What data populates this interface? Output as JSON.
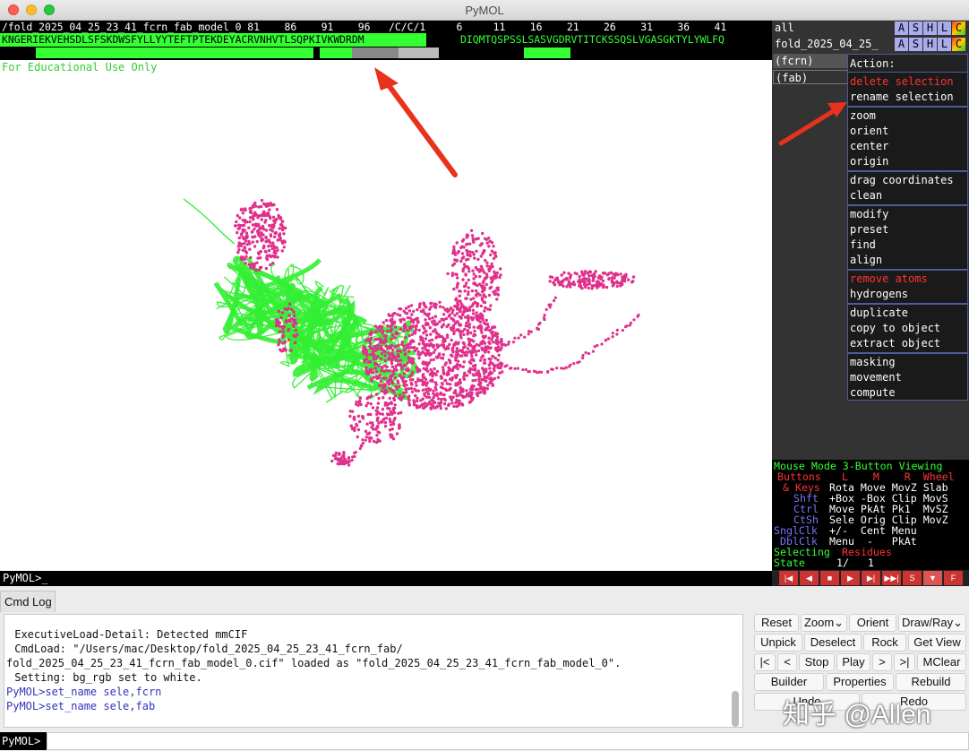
{
  "window": {
    "title": "PyMOL"
  },
  "sequence": {
    "header_line": "/fold_2025_04_25_23_41_fcrn_fab_model_0 81    86    91    96   /C/C/1     6     11    16    21    26    31    36    41",
    "chain_a_residues": "KNGERIEKVEHSDLSFSKDWSFYLLYYTEFTPTEKDEYACRVNHVTLSQPKIVKWDRDM",
    "chain_c_residues": "DIQMTQSPSSLSASVGDRVTITCKSSQSLVGASGKTYLYWLFQ",
    "track_colors": {
      "selected": "#33ff33",
      "highlight": "#888888",
      "dim": "#bbbbbb",
      "marker": "#000000"
    }
  },
  "viewer": {
    "notice": "For Educational Use Only",
    "command_prompt": "PyMOL>_",
    "colors": {
      "cartoon": "#33ee33",
      "sticks": "#e0308c",
      "background": "#ffffff"
    }
  },
  "objects": [
    {
      "name": "all"
    },
    {
      "name": "fold_2025_04_25_"
    },
    {
      "name": "(fcrn)"
    },
    {
      "name": "(fab)"
    }
  ],
  "asblc_buttons": [
    "A",
    "S",
    "H",
    "L",
    "C"
  ],
  "asblc_colors": {
    "A": "#aaaaee",
    "S": "#aaaaee",
    "H": "#aaaaee",
    "L": "#aaaaee",
    "C": "#ee7733"
  },
  "action_menu": {
    "title": "Action:",
    "groups": [
      [
        {
          "label": "delete selection",
          "danger": true
        },
        {
          "label": "rename selection",
          "danger": false
        }
      ],
      [
        {
          "label": "zoom"
        },
        {
          "label": "orient"
        },
        {
          "label": "center"
        },
        {
          "label": "origin"
        }
      ],
      [
        {
          "label": "drag coordinates"
        },
        {
          "label": "clean"
        }
      ],
      [
        {
          "label": "modify"
        },
        {
          "label": "preset"
        },
        {
          "label": "find"
        },
        {
          "label": "align"
        }
      ],
      [
        {
          "label": "remove atoms",
          "danger": true
        },
        {
          "label": "hydrogens"
        }
      ],
      [
        {
          "label": "duplicate"
        },
        {
          "label": "copy to object"
        },
        {
          "label": "extract object"
        }
      ],
      [
        {
          "label": "masking"
        },
        {
          "label": "movement"
        },
        {
          "label": "compute"
        }
      ]
    ]
  },
  "mouse_mode": {
    "title": "Mouse Mode 3-Button Viewing",
    "buttons_label": "Buttons",
    "columns": "L    M    R  Wheel",
    "rows": [
      {
        "key": "& Keys",
        "values": "Rota Move MovZ Slab"
      },
      {
        "key": "Shft",
        "values": "+Box -Box Clip MovS"
      },
      {
        "key": "Ctrl",
        "values": "Move PkAt Pk1  MvSZ"
      },
      {
        "key": "CtSh",
        "values": "Sele Orig Clip MovZ"
      },
      {
        "key": "SnglClk",
        "values": "+/-  Cent Menu"
      },
      {
        "key": "DblClk",
        "values": "Menu  -   PkAt"
      }
    ],
    "selecting_label": "Selecting",
    "selecting_value": "Residues",
    "state_label": "State",
    "state_value": "1/   1"
  },
  "player_buttons": [
    "|◀",
    "◀",
    "■",
    "▶",
    "▶|",
    "▶▶|",
    "S",
    "▼",
    "F"
  ],
  "log": {
    "tab": "Cmd Log",
    "lines": [
      {
        "text": " ExecutiveLoad-Detail: Detected mmCIF",
        "cmd": false
      },
      {
        "text": " CmdLoad: \"/Users/mac/Desktop/fold_2025_04_25_23_41_fcrn_fab/",
        "cmd": false
      },
      {
        "text": "fold_2025_04_25_23_41_fcrn_fab_model_0.cif\" loaded as \"fold_2025_04_25_23_41_fcrn_fab_model_0\".",
        "cmd": false
      },
      {
        "text": " Setting: bg_rgb set to white.",
        "cmd": false
      },
      {
        "text": "PyMOL>set_name sele,fcrn",
        "cmd": true
      },
      {
        "text": "PyMOL>set_name sele,fab",
        "cmd": true
      }
    ]
  },
  "controls": {
    "row1": [
      "Reset",
      "Zoom⌄",
      "Orient",
      "Draw/Ray⌄"
    ],
    "row2": [
      "Unpick",
      "Deselect",
      "Rock",
      "Get View"
    ],
    "row3": [
      "|<",
      "<",
      "Stop",
      "Play",
      ">",
      ">|",
      "MClear"
    ],
    "row4": [
      "Builder",
      "Properties",
      "Rebuild"
    ],
    "row5": [
      "Undo",
      "Redo"
    ]
  },
  "bottom_prompt": "PyMOL>",
  "watermark": "知乎 @Allen"
}
